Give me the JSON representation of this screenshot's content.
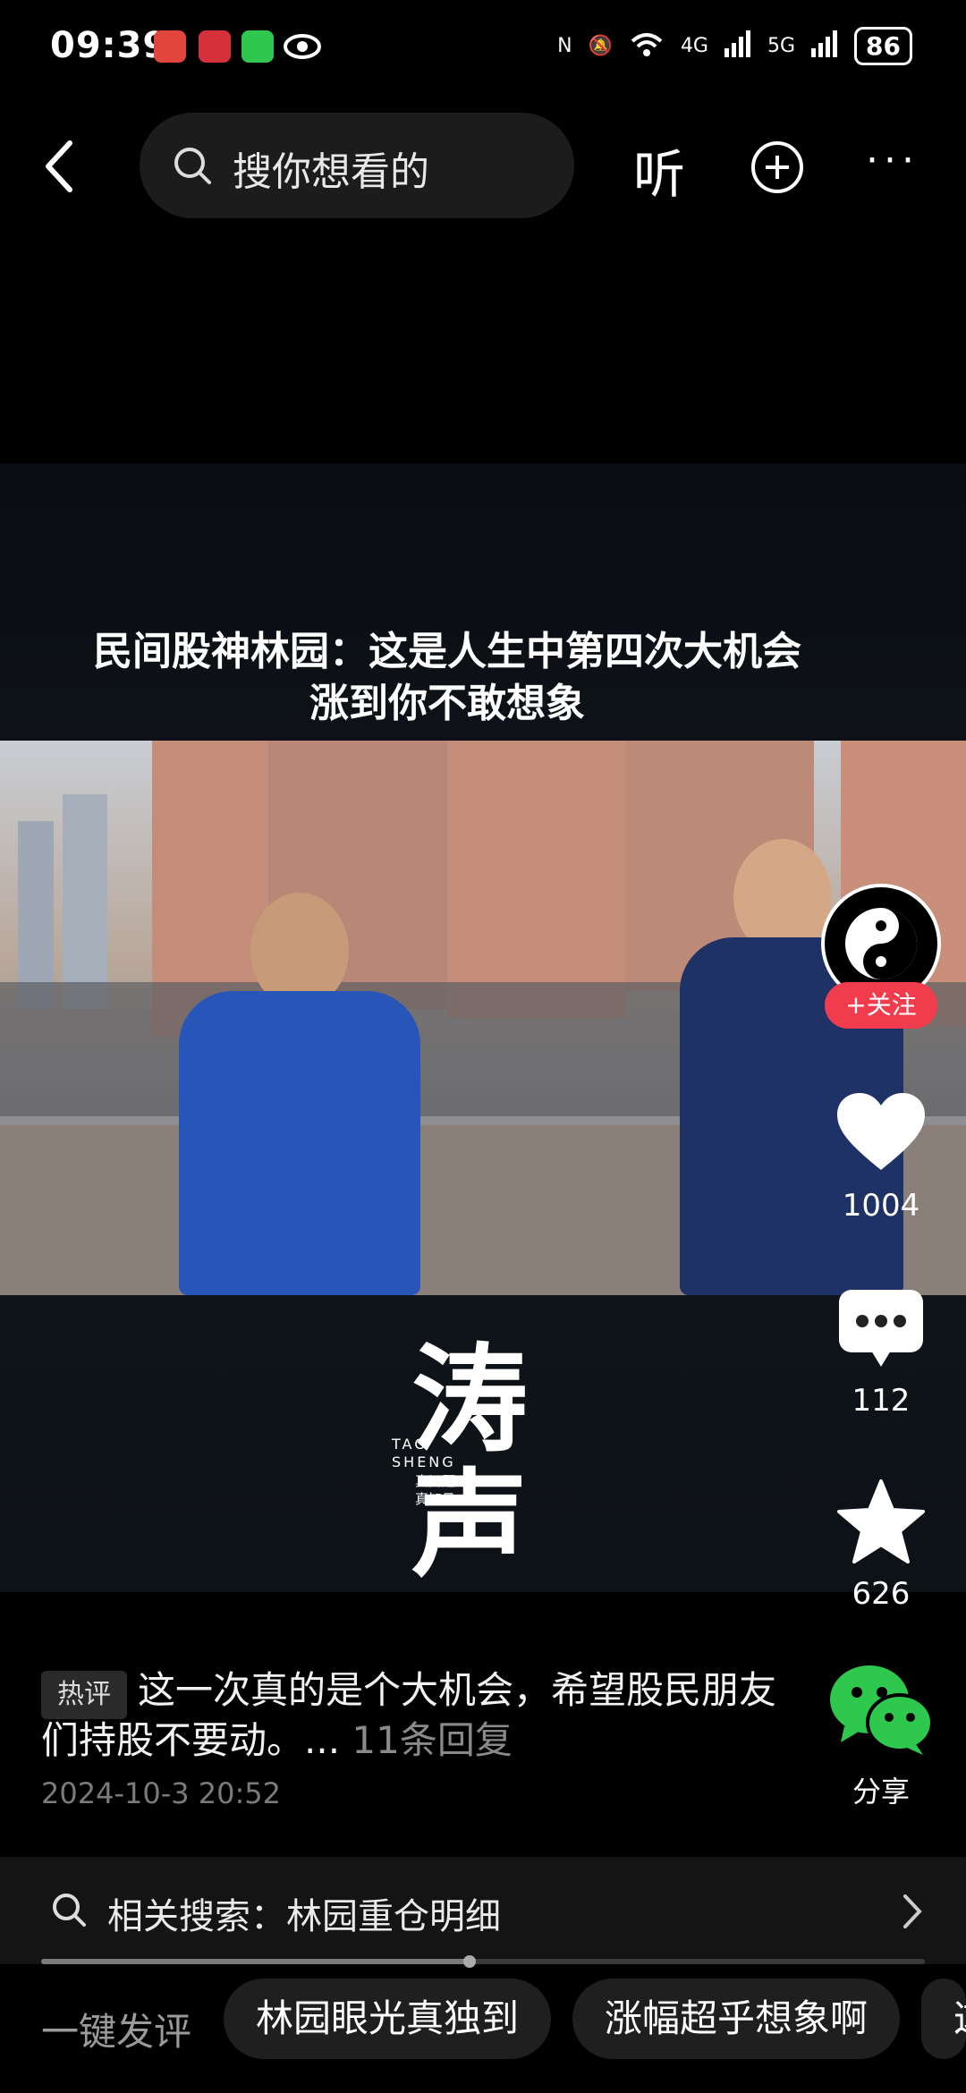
{
  "status_bar": {
    "time": "09:39",
    "battery": "86",
    "network1": "4G",
    "network2": "5G"
  },
  "top_bar": {
    "search_placeholder": "搜你想看的",
    "listen_label": "听",
    "more_label": "···"
  },
  "video": {
    "title_line1": "民间股神林园：这是人生中第四次大机会",
    "title_line2": "涨到你不敢想象",
    "logo_text": "涛声",
    "logo_sub1": "TAO",
    "logo_sub2": "SHENG",
    "logo_sub3": "真问题",
    "logo_sub4": "真知见"
  },
  "rail": {
    "follow_label": "+关注",
    "likes": "1004",
    "comments": "112",
    "favorites": "626",
    "share_label": "分享"
  },
  "comment": {
    "tag": "热评",
    "text": "这一次真的是个大机会，希望股民朋友们持股不要动。...",
    "replies": "11条回复",
    "date": "2024-10-3 20:52"
  },
  "related": {
    "label": "相关搜索：林园重仓明细"
  },
  "progress": {
    "fraction": 0.485
  },
  "quick": {
    "label": "一键发评",
    "chips": [
      "林园眼光真独到",
      "涨幅超乎想象啊",
      "这"
    ]
  },
  "colors": {
    "follow_red": "#f03c4c",
    "wechat_green": "#2dc84d"
  }
}
